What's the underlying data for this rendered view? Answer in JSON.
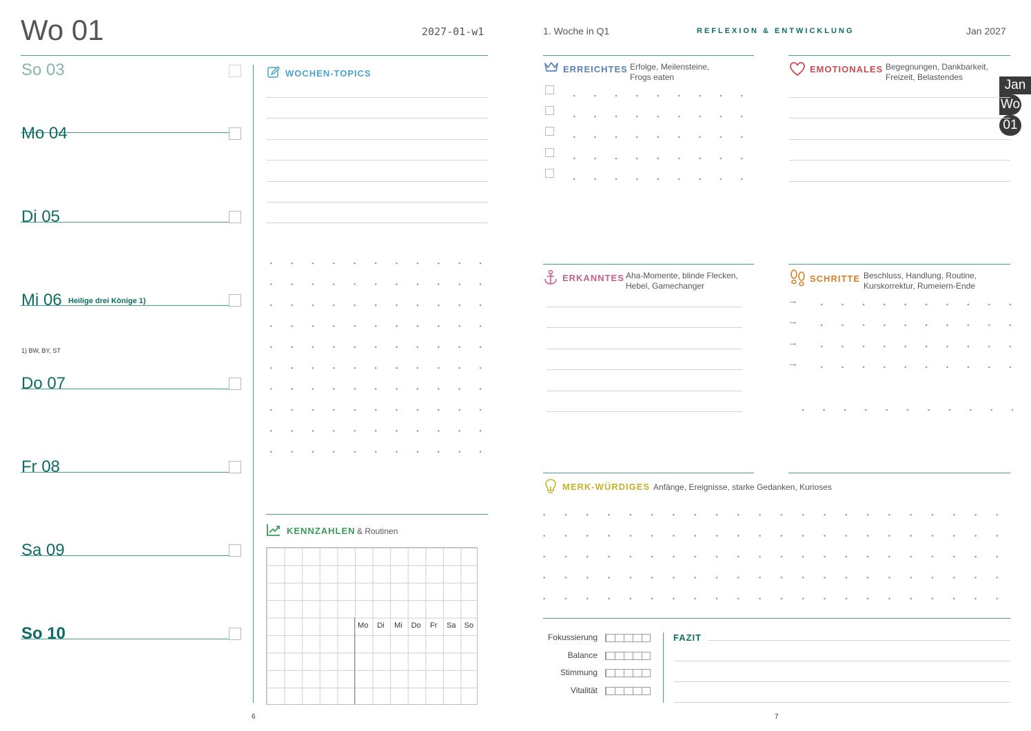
{
  "left_page": {
    "week_title": "Wo 01",
    "week_code": "2027-01-w1",
    "page_number": "6",
    "days": [
      {
        "label": "So 03",
        "note": "",
        "footnote": ""
      },
      {
        "label": "Mo 04",
        "note": "",
        "footnote": ""
      },
      {
        "label": "Di 05",
        "note": "",
        "footnote": ""
      },
      {
        "label": "Mi 06",
        "note": "Heilige drei Könige 1)",
        "footnote": "1) BW, BY, ST"
      },
      {
        "label": "Do 07",
        "note": "",
        "footnote": ""
      },
      {
        "label": "Fr 08",
        "note": "",
        "footnote": ""
      },
      {
        "label": "Sa 09",
        "note": "",
        "footnote": ""
      },
      {
        "label": "So 10",
        "note": "",
        "footnote": ""
      }
    ],
    "topics": {
      "label": "WOCHEN-TOPICS",
      "icon": "pencil-icon"
    },
    "kennzahlen": {
      "label": "KENNZAHLEN",
      "sub": "& Routinen",
      "icon": "chart-trend-icon",
      "weekdays": [
        "Mo",
        "Di",
        "Mi",
        "Do",
        "Fr",
        "Sa",
        "So"
      ]
    }
  },
  "right_page": {
    "week_info": "1. Woche in Q1",
    "heading": "REFLEXION & ENTWICKLUNG",
    "month": "Jan 2027",
    "page_number": "7",
    "tab": {
      "month": "Jan",
      "wo": "Wo",
      "num": "01"
    },
    "erreichtes": {
      "label": "ERREICHTES",
      "desc1": "Erfolge, Meilensteine,",
      "desc2": "Frogs eaten",
      "icon": "crown-icon",
      "color": "#5b7fb0"
    },
    "emotionales": {
      "label": "EMOTIONALES",
      "desc1": "Begegnungen, Dankbarkeit,",
      "desc2": "Freizeit, Belastendes",
      "icon": "heart-icon",
      "color": "#c84a52"
    },
    "erkanntes": {
      "label": "ERKANNTES",
      "desc1": "Aha-Momente, blinde Flecken,",
      "desc2": "Hebel, Gamechanger",
      "icon": "anchor-icon",
      "color": "#c0618a"
    },
    "schritte": {
      "label": "SCHRITTE",
      "desc1": "Beschluss, Handlung, Routine,",
      "desc2": "Kurskorrektur, Rumeiern-Ende",
      "icon": "footsteps-icon",
      "color": "#d27f2a"
    },
    "merk": {
      "label": "MERK-WÜRDIGES",
      "desc": "Anfänge, Ereignisse, starke Gedanken, Kurioses",
      "icon": "lightbulb-icon",
      "color": "#c2b22e"
    },
    "ratings": [
      "Fokussierung",
      "Balance",
      "Stimmung",
      "Vitalität"
    ],
    "fazit": "FAZIT"
  }
}
